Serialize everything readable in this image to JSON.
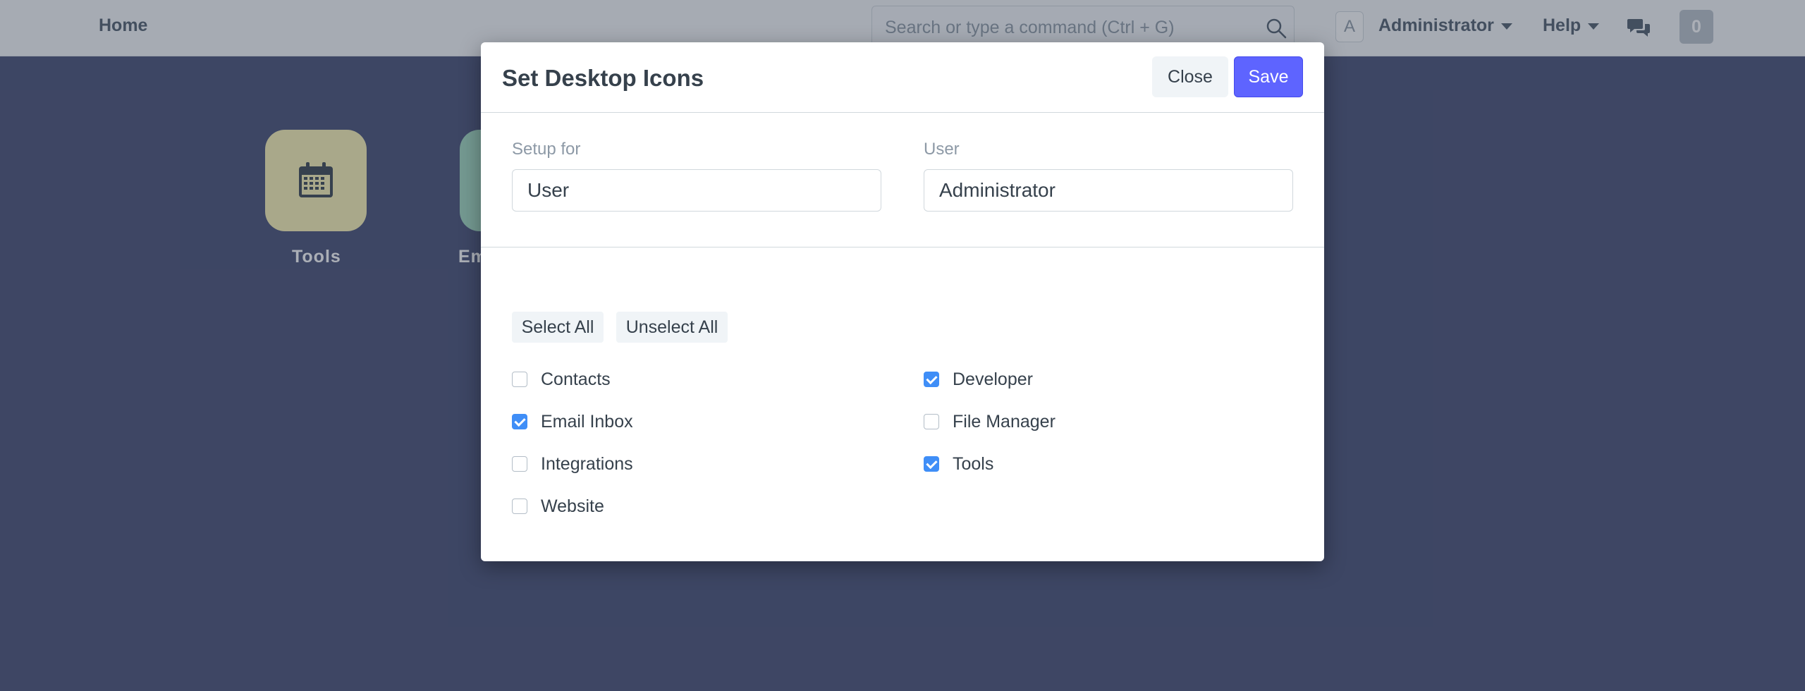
{
  "navbar": {
    "home_label": "Home",
    "search_placeholder": "Search or type a command (Ctrl + G)",
    "avatar_initial": "A",
    "user_label": "Administrator",
    "help_label": "Help",
    "notification_count": "0"
  },
  "desktop": {
    "icons": [
      {
        "label": "Tools",
        "icon": "calendar-icon",
        "color": "#fbf3b3"
      },
      {
        "label": "Em",
        "icon": "unknown-icon",
        "color": "#a1d9c0"
      }
    ]
  },
  "modal": {
    "title": "Set Desktop Icons",
    "close_label": "Close",
    "save_label": "Save",
    "setup_for_label": "Setup for",
    "setup_for_value": "User",
    "user_label": "User",
    "user_value": "Administrator",
    "select_all_label": "Select All",
    "unselect_all_label": "Unselect All",
    "modules": [
      {
        "label": "Contacts",
        "checked": false
      },
      {
        "label": "Developer",
        "checked": true
      },
      {
        "label": "Email Inbox",
        "checked": true
      },
      {
        "label": "File Manager",
        "checked": false
      },
      {
        "label": "Integrations",
        "checked": false
      },
      {
        "label": "Tools",
        "checked": true
      },
      {
        "label": "Website",
        "checked": false
      }
    ]
  },
  "colors": {
    "accent": "#5e64ff",
    "checkbox_checked": "#3f8ef7",
    "desktop_background": "#434a72"
  }
}
